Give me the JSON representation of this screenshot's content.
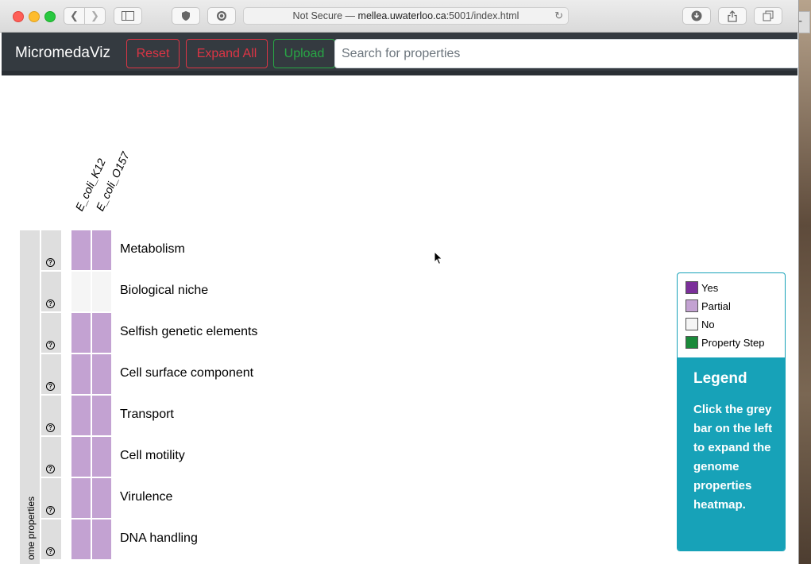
{
  "browser": {
    "address_prefix": "Not Secure — ",
    "address_domain": "mellea.uwaterloo.ca",
    "address_path": ":5001/index.html"
  },
  "navbar": {
    "brand": "MicromedaViz",
    "reset_label": "Reset",
    "expand_label": "Expand All",
    "upload_label": "Upload",
    "search_placeholder": "Search for properties"
  },
  "heatmap": {
    "columns": [
      "E_coli_K12",
      "E_coli_O157"
    ],
    "root_label": "ome properties",
    "help_glyph": "?",
    "rows": [
      {
        "label": "Metabolism",
        "values": [
          "Partial",
          "Partial"
        ]
      },
      {
        "label": "Biological niche",
        "values": [
          "No",
          "No"
        ]
      },
      {
        "label": "Selfish genetic elements",
        "values": [
          "Partial",
          "Partial"
        ]
      },
      {
        "label": "Cell surface component",
        "values": [
          "Partial",
          "Partial"
        ]
      },
      {
        "label": "Transport",
        "values": [
          "Partial",
          "Partial"
        ]
      },
      {
        "label": "Cell motility",
        "values": [
          "Partial",
          "Partial"
        ]
      },
      {
        "label": "Virulence",
        "values": [
          "Partial",
          "Partial"
        ]
      },
      {
        "label": "DNA handling",
        "values": [
          "Partial",
          "Partial"
        ]
      }
    ]
  },
  "colors": {
    "Yes": "#7b2f9a",
    "Partial": "#c3a2d2",
    "No": "#f5f5f5",
    "Property Step": "#1a8a3a"
  },
  "legend": {
    "items": [
      {
        "label": "Yes",
        "color": "#7b2f9a"
      },
      {
        "label": "Partial",
        "color": "#c3a2d2"
      },
      {
        "label": "No",
        "color": "#f5f5f5"
      },
      {
        "label": "Property Step",
        "color": "#1a8a3a"
      }
    ],
    "title": "Legend",
    "text": "Click the grey bar on the left to expand the genome properties heatmap."
  }
}
